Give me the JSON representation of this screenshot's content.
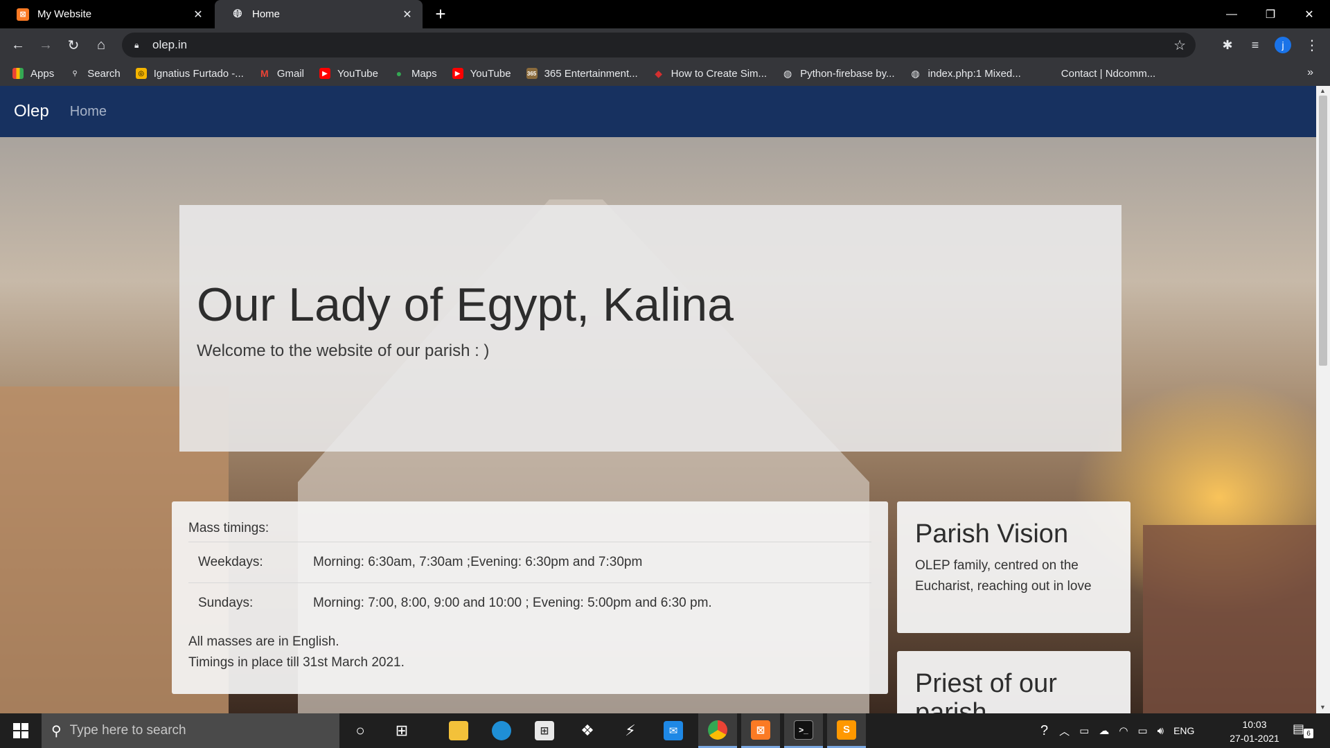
{
  "browser": {
    "tabs": [
      {
        "title": "My Website",
        "active": false,
        "favicon": "xampp-icon"
      },
      {
        "title": "Home",
        "active": true,
        "favicon": "globe-icon"
      }
    ],
    "new_tab_glyph": "+",
    "window_controls": {
      "minimize": "—",
      "restore": "❐",
      "close": "✕"
    },
    "url": "olep.in",
    "avatar_letter": "j",
    "bookmarks": [
      {
        "label": "Apps",
        "icon": "apps-grid-icon"
      },
      {
        "label": "Search",
        "icon": "search-icon"
      },
      {
        "label": "Ignatius Furtado -...",
        "icon": "bookmark-yellow-icon"
      },
      {
        "label": "Gmail",
        "icon": "gmail-icon"
      },
      {
        "label": "YouTube",
        "icon": "youtube-icon"
      },
      {
        "label": "Maps",
        "icon": "maps-icon"
      },
      {
        "label": "YouTube",
        "icon": "youtube-icon"
      },
      {
        "label": "365 Entertainment...",
        "icon": "365-icon"
      },
      {
        "label": "How to Create Sim...",
        "icon": "bookmark-red-icon"
      },
      {
        "label": "Python-firebase by...",
        "icon": "globe-icon"
      },
      {
        "label": "index.php:1 Mixed...",
        "icon": "globe-icon"
      },
      {
        "label": "Contact | Ndcomm...",
        "icon": ""
      }
    ],
    "more_glyph": "»"
  },
  "site": {
    "brand": "Olep",
    "nav_home": "Home",
    "hero": {
      "title": "Our Lady of Egypt, Kalina",
      "subtitle": "Welcome to the website of our parish : )"
    },
    "mass": {
      "heading": "Mass timings:",
      "rows": [
        {
          "day": "Weekdays:",
          "times": "Morning: 6:30am, 7:30am ;Evening: 6:30pm and 7:30pm"
        },
        {
          "day": "Sundays:",
          "times": "Morning: 7:00, 8:00, 9:00 and 10:00 ; Evening: 5:00pm and 6:30 pm."
        }
      ],
      "note_1": "All masses are in English.",
      "note_2": "Timings in place till 31st March 2021."
    },
    "vision": {
      "title": "Parish Vision",
      "text": "OLEP family, centred on the Eucharist, reaching out in love"
    },
    "priest": {
      "title": "Priest of our parish"
    }
  },
  "taskbar": {
    "search_placeholder": "Type here to search",
    "language": "ENG",
    "time": "10:03",
    "date": "27-01-2021",
    "notification_count": "6"
  },
  "colors": {
    "navbar": "#173160",
    "browser_chrome": "#35363a",
    "taskbar": "#1f1f1f"
  }
}
